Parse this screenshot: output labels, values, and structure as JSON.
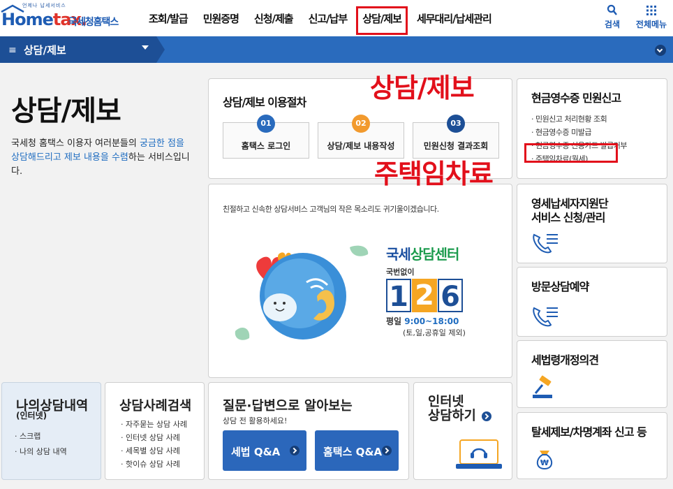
{
  "header": {
    "logo_tagline": "언제나 납세서비스",
    "logo_home": "Home",
    "logo_tax": "tax.",
    "logo_nts": "국세청홈택스",
    "menu": [
      "조회/발급",
      "민원증명",
      "신청/제출",
      "신고/납부",
      "상담/제보",
      "세무대리/납세관리"
    ],
    "active_menu": "상담/제보",
    "search_label": "검색",
    "allmenu_label": "전체메뉴"
  },
  "nav": {
    "breadcrumb": "상담/제보"
  },
  "intro": {
    "title": "상담/제보",
    "desc_1": "국세청 홈택스 이용자 여러분들의 ",
    "desc_hl_1": "궁금한 점을 상담해드리고",
    "desc_2": " ",
    "desc_hl_2": "제보 내용을 수렴",
    "desc_3": "하는 서비스입니다."
  },
  "procedure": {
    "title": "상담/제보 이용절차",
    "steps": [
      {
        "num": "01",
        "label": "홈택스 로그인",
        "color": "#2a6bbd"
      },
      {
        "num": "02",
        "label": "상담/제보 내용작성",
        "color": "#f29a2e"
      },
      {
        "num": "03",
        "label": "민원신청 결과조회",
        "color": "#1d4f96"
      }
    ]
  },
  "annotations": {
    "top": "상담/제보",
    "bottom": "주택임차료"
  },
  "center": {
    "message": "친절하고 신속한 상담서비스 고객님의 작은 목소리도 귀기울이겠습니다.",
    "brand_a": "국세",
    "brand_b": "상담센터",
    "no_area": "국번없이",
    "number": [
      "1",
      "2",
      "6"
    ],
    "weekday_label": "평일",
    "hours": "9:00~18:00",
    "closed": "(토,일,공휴일 제외)"
  },
  "cash_receipt": {
    "title": "현금영수증 민원신고",
    "items": [
      "· 민원신고 처리현황 조회",
      "· 현금영수증 미발급",
      "· 현금영수증 신용카드 발급거부",
      "· 주택임차료(월세)"
    ]
  },
  "side_cards": {
    "biz_title_1": "영세납세자지원단",
    "biz_title_2": "서비스 신청/관리",
    "visit_title": "방문상담예약",
    "law_title": "세법령개정의견",
    "report_title": "탈세제보/차명계좌 신고 등"
  },
  "bottom": {
    "my_title": "나의상담내역",
    "my_sub": "(인터넷)",
    "my_items": [
      "· 스크랩",
      "· 나의 상담 내역"
    ],
    "cases_title": "상담사례검색",
    "cases_items": [
      "· 자주묻는 상담 사례",
      "· 인터넷 상담 사례",
      "· 세목별 상담 사례",
      "· 핫이슈 상담 사례"
    ],
    "qa_title": "질문·답변으로 알아보는",
    "qa_sub": "상담 전 활용하세요!",
    "qa_btn_1": "세법 Q&A",
    "qa_btn_2": "홈택스 Q&A",
    "inet_title_1": "인터넷",
    "inet_title_2": "상담하기"
  }
}
